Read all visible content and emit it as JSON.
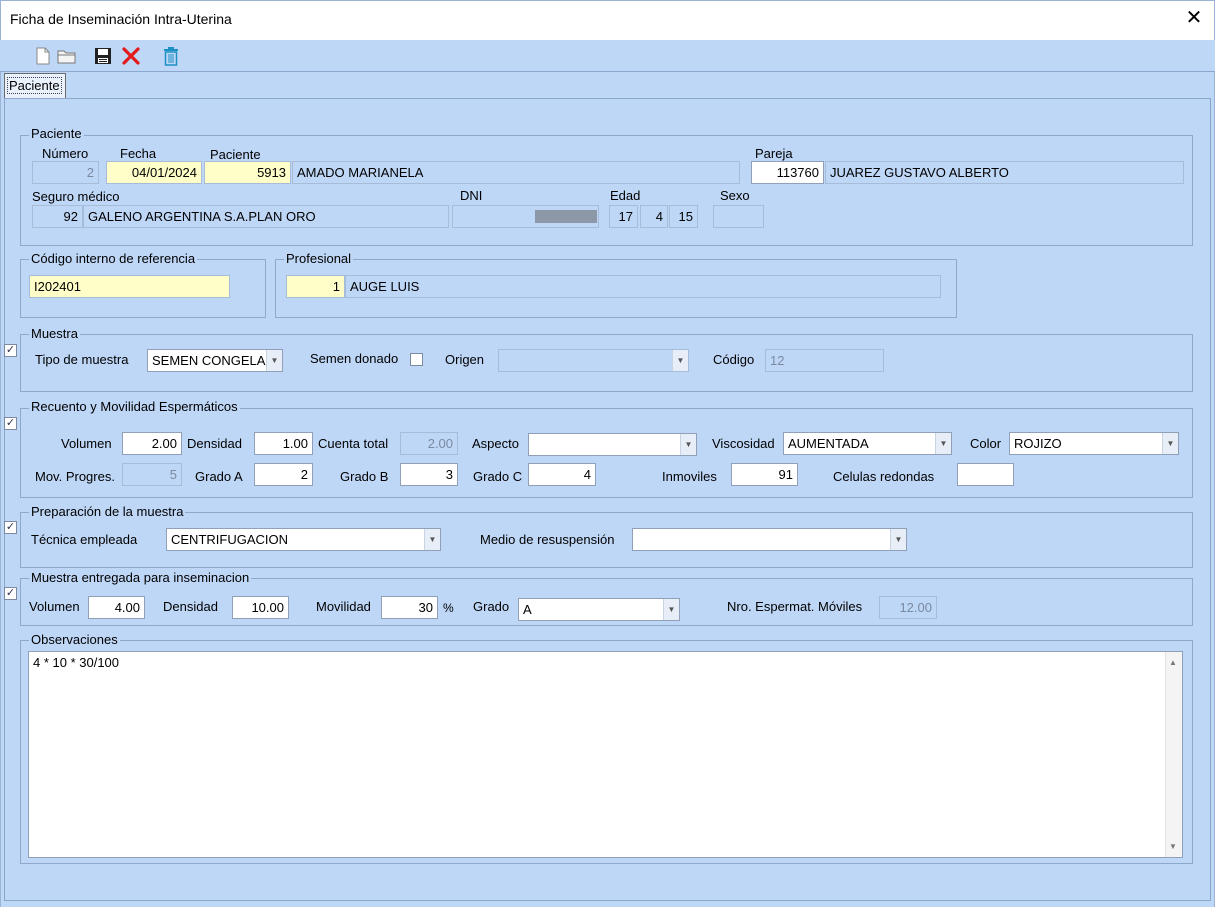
{
  "window": {
    "title": "Ficha de Inseminación Intra-Uterina",
    "close_glyph": "✕"
  },
  "toolbar": {
    "icons": [
      "new-document-icon",
      "open-folder-icon",
      "save-icon",
      "cancel-x-icon",
      "trash-icon"
    ]
  },
  "tab": {
    "label": "Paciente"
  },
  "paciente": {
    "legend": "Paciente",
    "numero_label": "Número",
    "numero": "2",
    "fecha_label": "Fecha",
    "fecha": "04/01/2024",
    "paciente_label": "Paciente",
    "paciente_id": "5913",
    "paciente_nombre": "AMADO MARIANELA",
    "pareja_label": "Pareja",
    "pareja_id": "113760",
    "pareja_nombre": "JUAREZ GUSTAVO ALBERTO",
    "seguro_label": "Seguro médico",
    "seguro_id": "92",
    "seguro_nombre": "GALENO ARGENTINA S.A.PLAN ORO",
    "dni_label": "DNI",
    "edad_label": "Edad",
    "edad_anios": "17",
    "edad_meses": "4",
    "edad_dias": "15",
    "sexo_label": "Sexo",
    "sexo": ""
  },
  "codigo_interno": {
    "legend": "Código interno de referencia",
    "value": "I202401"
  },
  "profesional": {
    "legend": "Profesional",
    "id": "1",
    "nombre": "AUGE LUIS"
  },
  "muestra": {
    "legend": "Muestra",
    "tipo_label": "Tipo de muestra",
    "tipo_value": "SEMEN CONGELA",
    "semen_donado_label": "Semen donado",
    "origen_label": "Origen",
    "origen_value": "",
    "codigo_label": "Código",
    "codigo_value": "12"
  },
  "recuento": {
    "legend": "Recuento y Movilidad Espermáticos",
    "volumen_label": "Volumen",
    "volumen": "2.00",
    "densidad_label": "Densidad",
    "densidad": "1.00",
    "cuenta_total_label": "Cuenta total",
    "cuenta_total": "2.00",
    "aspecto_label": "Aspecto",
    "aspecto": "",
    "viscosidad_label": "Viscosidad",
    "viscosidad": "AUMENTADA",
    "color_label": "Color",
    "color": "ROJIZO",
    "mov_progres_label": "Mov. Progres.",
    "mov_progres": "5",
    "grado_a_label": "Grado A",
    "grado_a": "2",
    "grado_b_label": "Grado B",
    "grado_b": "3",
    "grado_c_label": "Grado C",
    "grado_c": "4",
    "inmoviles_label": "Inmoviles",
    "inmoviles": "91",
    "celulas_label": "Celulas redondas",
    "celulas": ""
  },
  "preparacion": {
    "legend": "Preparación de la muestra",
    "tecnica_label": "Técnica empleada",
    "tecnica": "CENTRIFUGACION",
    "medio_label": "Medio de resuspensión",
    "medio": ""
  },
  "entregada": {
    "legend": "Muestra entregada para inseminacion",
    "volumen_label": "Volumen",
    "volumen": "4.00",
    "densidad_label": "Densidad",
    "densidad": "10.00",
    "movilidad_label": "Movilidad",
    "movilidad": "30",
    "pct": "%",
    "grado_label": "Grado",
    "grado": "A",
    "nro_label": "Nro. Espermat. Móviles",
    "nro": "12.00"
  },
  "observaciones": {
    "legend": "Observaciones",
    "text": "4 * 10 * 30/100"
  }
}
